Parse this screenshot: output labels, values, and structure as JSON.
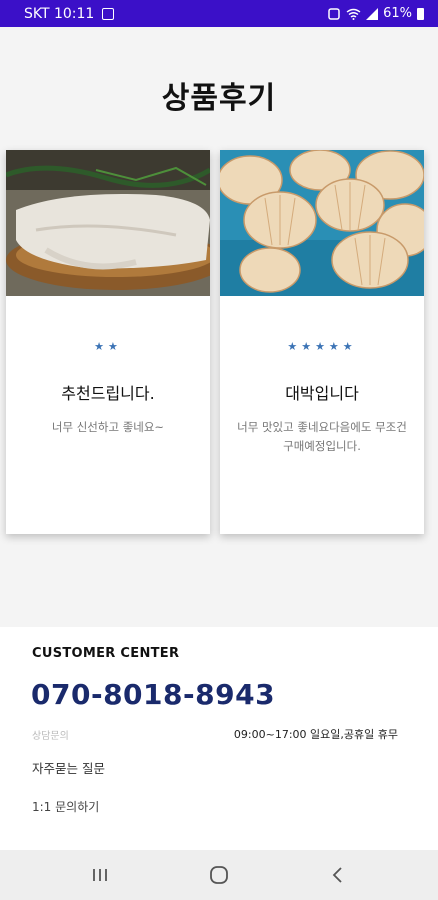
{
  "status_bar": {
    "carrier_time": "SKT 10:11",
    "battery": "61%",
    "icons": [
      "gallery-icon",
      "alarm-icon",
      "wifi-icon",
      "signal-icon",
      "battery-icon"
    ]
  },
  "page": {
    "title": "상품후기"
  },
  "reviews": [
    {
      "image": "fish-photo",
      "stars": "★★",
      "rating": 2,
      "title": "추천드립니다.",
      "text": "너무 신선하고 좋네요~"
    },
    {
      "image": "scallop-photo",
      "stars": "★★★★★",
      "rating": 5,
      "title": "대박입니다",
      "text": "너무 맛있고 좋네요다음에도 무조건 구매예정입니다."
    }
  ],
  "footer": {
    "customer_center_label": "CUSTOMER CENTER",
    "phone": "070-8018-8943",
    "consult_label": "상담문의",
    "hours": "09:00~17:00 일요일,공휴일 휴무",
    "faq": "자주묻는 질문",
    "inquiry": "1:1 문의하기"
  },
  "nav_bar": {
    "buttons": [
      "recent-apps-icon",
      "home-icon",
      "back-icon"
    ]
  },
  "colors": {
    "status_bar": "#3b10c8",
    "star": "#3b73b5",
    "phone": "#1a2a6c"
  }
}
